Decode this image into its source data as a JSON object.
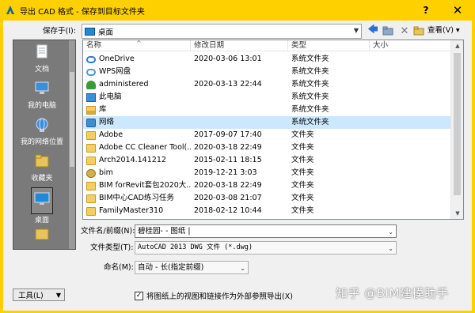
{
  "window": {
    "title": "导出 CAD 格式 - 保存到目标文件夹",
    "help_glyph": "?",
    "close_glyph": "✕"
  },
  "toolbar": {
    "save_in_label": "保存于(I):",
    "save_in_value": "桌面",
    "views_label": "查看(V) ▾"
  },
  "places": [
    {
      "label": "文档",
      "icon": "documents-icon"
    },
    {
      "label": "我的电脑",
      "icon": "computer-icon"
    },
    {
      "label": "我的网络位置",
      "icon": "network-globe-icon"
    },
    {
      "label": "收藏夹",
      "icon": "favorites-folder-icon"
    },
    {
      "label": "桌面",
      "icon": "desktop-icon",
      "selected": true
    }
  ],
  "columns": {
    "name": "名称",
    "date": "修改日期",
    "type": "类型",
    "size": "大小"
  },
  "files": [
    {
      "name": "OneDrive",
      "date": "2020-03-06 13:01",
      "type": "系统文件夹",
      "icon": "onedrive-icon"
    },
    {
      "name": "WPS网盘",
      "date": "",
      "type": "系统文件夹",
      "icon": "wps-cloud-icon"
    },
    {
      "name": "administered",
      "date": "2020-03-13 22:44",
      "type": "系统文件夹",
      "icon": "user-icon"
    },
    {
      "name": "此电脑",
      "date": "",
      "type": "系统文件夹",
      "icon": "this-pc-icon"
    },
    {
      "name": "库",
      "date": "",
      "type": "系统文件夹",
      "icon": "library-icon"
    },
    {
      "name": "网络",
      "date": "",
      "type": "系统文件夹",
      "icon": "network-icon",
      "highlighted": true
    },
    {
      "name": "Adobe",
      "date": "2017-09-07 17:40",
      "type": "文件夹",
      "icon": "folder-icon"
    },
    {
      "name": "Adobe CC Cleaner Tool(...",
      "date": "2020-03-18 22:49",
      "type": "文件夹",
      "icon": "folder-icon"
    },
    {
      "name": "Arch2014.141212",
      "date": "2015-02-11 18:15",
      "type": "文件夹",
      "icon": "folder-icon"
    },
    {
      "name": "bim",
      "date": "2019-12-21 3:03",
      "type": "文件夹",
      "icon": "bim-icon"
    },
    {
      "name": "BIM forRevit套包2020大...",
      "date": "2020-03-18 22:49",
      "type": "文件夹",
      "icon": "folder-icon"
    },
    {
      "name": "BIM中心CAD练习任务",
      "date": "2020-03-08 21:07",
      "type": "文件夹",
      "icon": "folder-icon"
    },
    {
      "name": "FamilyMaster310",
      "date": "2018-02-12 10:44",
      "type": "文件夹",
      "icon": "folder-icon"
    }
  ],
  "form": {
    "filename_label": "文件名/前缀(N):",
    "filename_value": "碧桂园- - 图纸 |",
    "filetype_label": "文件类型(T):",
    "filetype_value": "AutoCAD 2013 DWG 文件  (*.dwg)",
    "naming_label": "命名(M):",
    "naming_value": "自动 - 长(指定前缀)",
    "tools_label": "工具(L)",
    "checkbox_label": "将图纸上的视图和链接作为外部参照导出(X)",
    "checkbox_checked": true,
    "checkbox_mark": "✓"
  },
  "watermark": "知乎 @BIM建模助手",
  "colors": {
    "title_bar": "#ffd000",
    "selection": "#cce8ff",
    "places_bg": "#7a7a7a"
  }
}
